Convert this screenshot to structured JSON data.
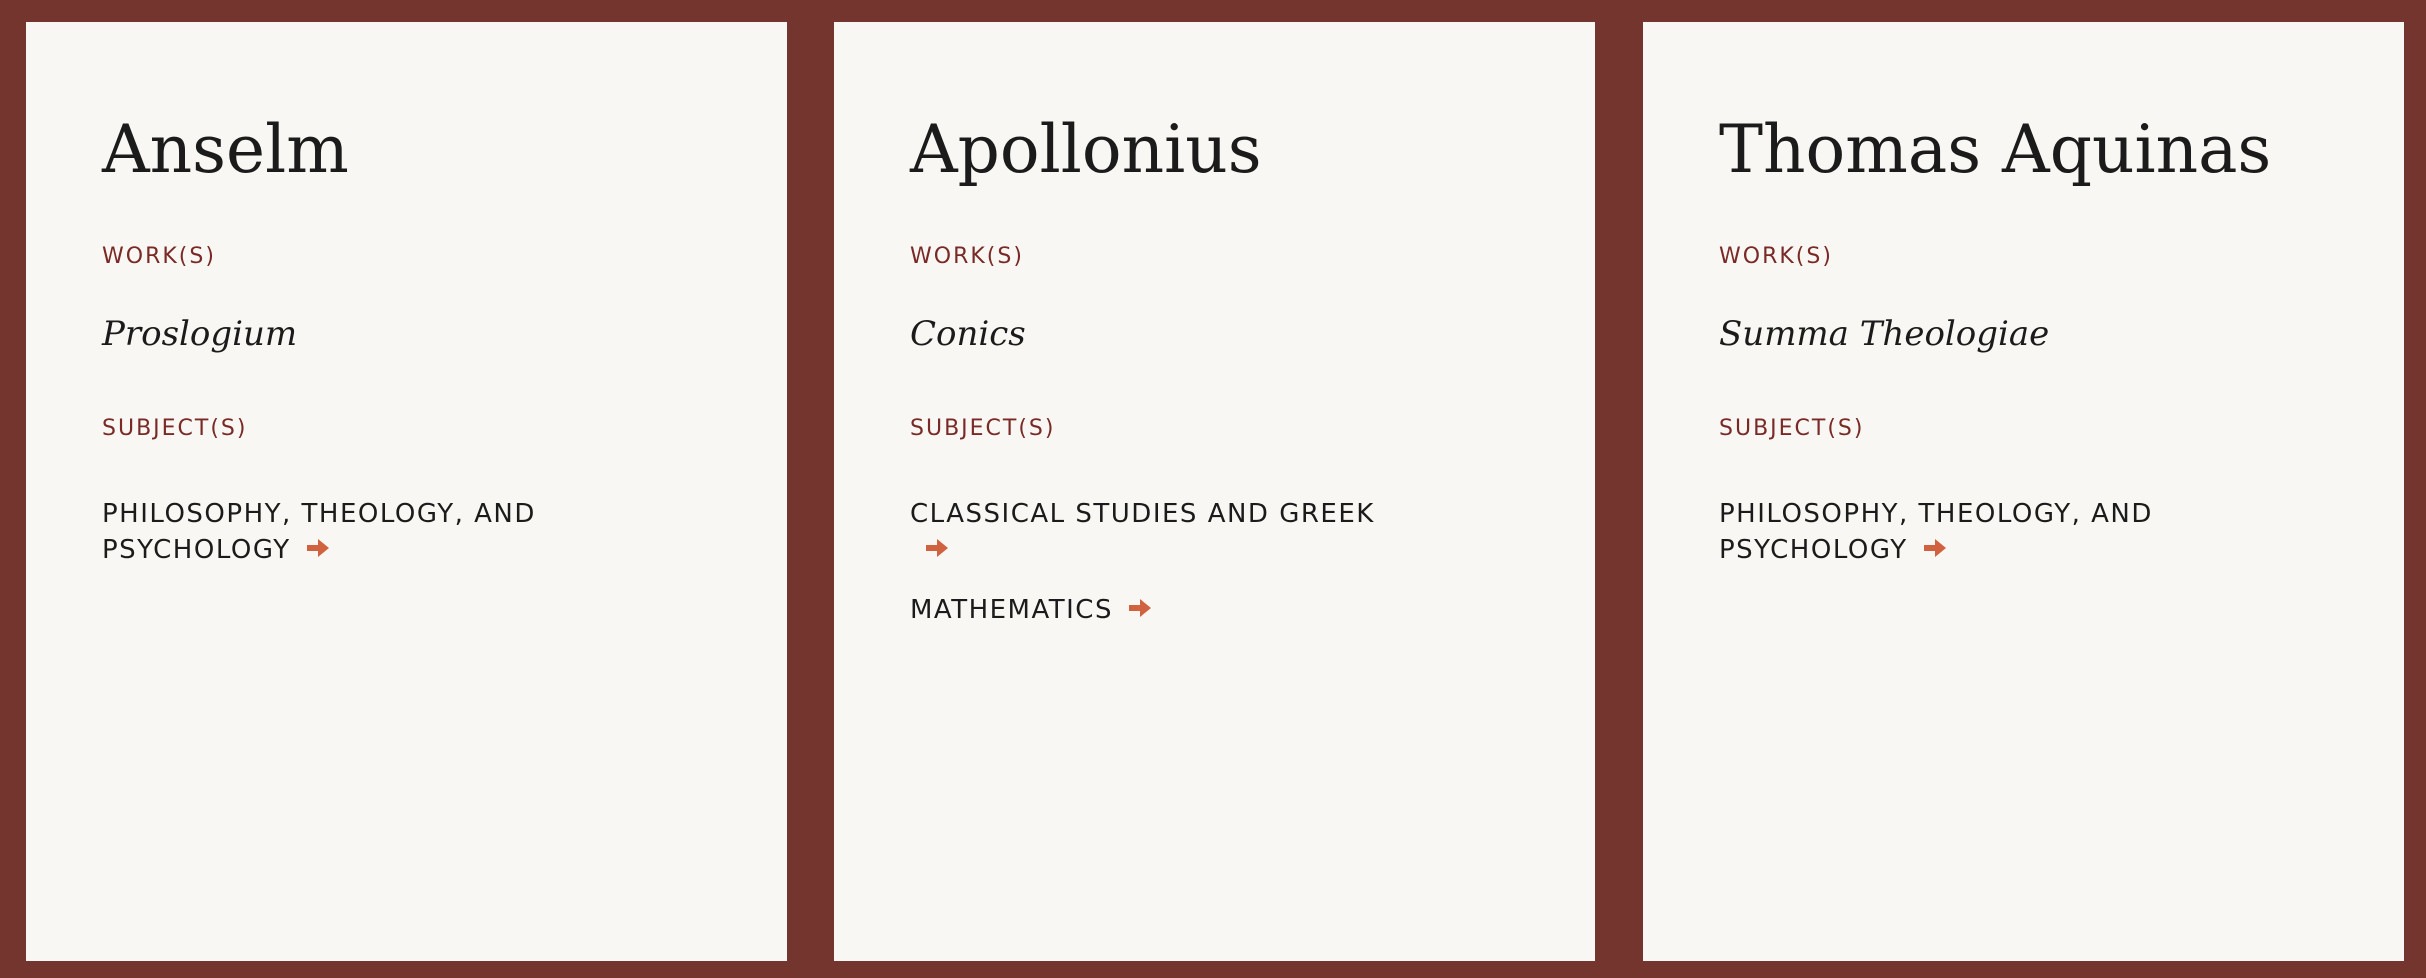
{
  "labels": {
    "works": "WORK(S)",
    "subjects": "SUBJECT(S)"
  },
  "colors": {
    "background": "#74352e",
    "card": "#f9f7f3",
    "label": "#7a2a26",
    "text": "#1b1b1b",
    "arrow": "#d0623f"
  },
  "cards": [
    {
      "author": "Anselm",
      "works": [
        "Proslogium"
      ],
      "subjects": [
        "PHILOSOPHY, THEOLOGY, AND PSYCHOLOGY"
      ]
    },
    {
      "author": "Apollonius",
      "works": [
        "Conics"
      ],
      "subjects": [
        "CLASSICAL STUDIES AND GREEK",
        "MATHEMATICS"
      ]
    },
    {
      "author": "Thomas Aquinas",
      "works": [
        "Summa Theologiae"
      ],
      "subjects": [
        "PHILOSOPHY, THEOLOGY, AND PSYCHOLOGY"
      ]
    }
  ],
  "icons": {
    "subject_link": "arrow-right-icon"
  }
}
